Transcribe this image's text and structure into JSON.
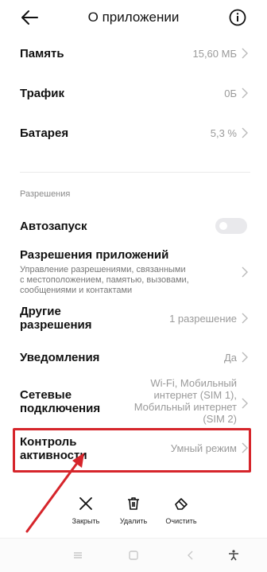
{
  "header": {
    "title": "О приложении",
    "back_icon": "arrow-left-icon",
    "info_icon": "info-circle-icon"
  },
  "rows_top": [
    {
      "label": "Память",
      "value": "15,60 МБ"
    },
    {
      "label": "Трафик",
      "value": "0Б"
    },
    {
      "label": "Батарея",
      "value": "5,3 %"
    }
  ],
  "permissions": {
    "section_title": "Разрешения",
    "autostart": {
      "label": "Автозапуск",
      "enabled": false
    },
    "app_permissions": {
      "label": "Разрешения приложений",
      "desc_lines": [
        "Управление разрешениями, связанными",
        "с местоположением, памятью, вызовами,",
        "сообщениями и контактами"
      ]
    },
    "other": {
      "label_lines": [
        "Другие",
        "разрешения"
      ],
      "value": "1 разрешение"
    },
    "notifications": {
      "label": "Уведомления",
      "value": "Да"
    },
    "network": {
      "label_lines": [
        "Сетевые",
        "подключения"
      ],
      "value_lines": [
        "Wi-Fi, Мобильный",
        "интернет (SIM 1),",
        "Мобильный интернет",
        "(SIM 2)"
      ]
    },
    "activity": {
      "label_lines": [
        "Контроль",
        "активности"
      ],
      "value": "Умный режим"
    }
  },
  "actions": [
    {
      "label": "Закрыть",
      "icon": "close-icon"
    },
    {
      "label": "Удалить",
      "icon": "trash-icon"
    },
    {
      "label": "Очистить",
      "icon": "eraser-icon"
    }
  ],
  "annotation": {
    "color": "#d6252b"
  },
  "navbar": {
    "icons": [
      "menu-icon",
      "home-square-icon",
      "back-triangle-icon",
      "accessibility-icon"
    ]
  }
}
